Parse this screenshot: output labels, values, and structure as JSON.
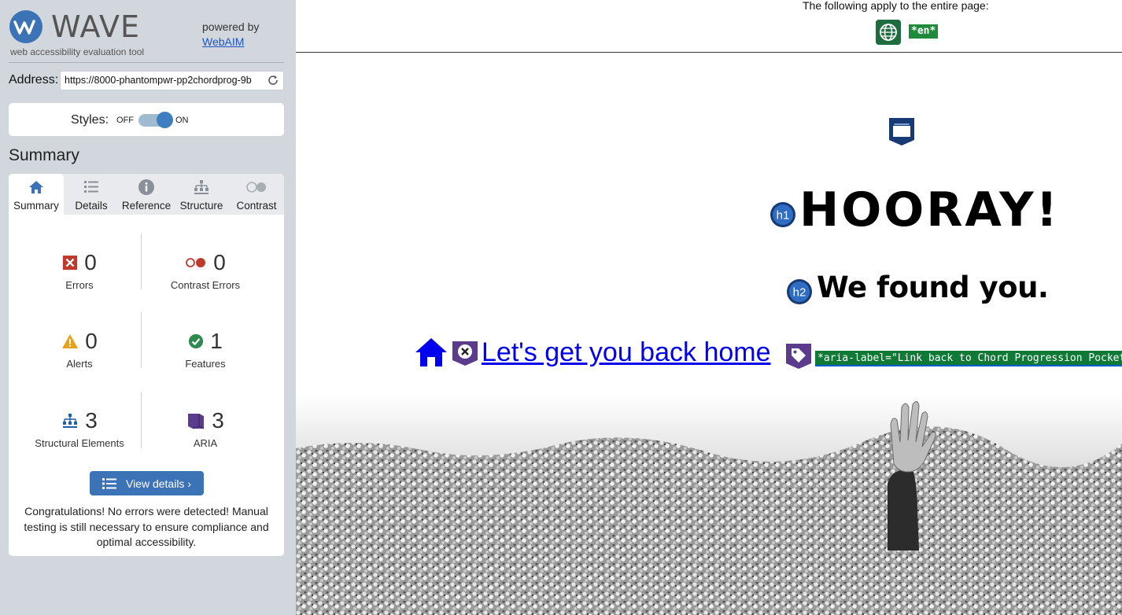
{
  "sidebar": {
    "brand": {
      "name": "WAVE",
      "tagline": "web accessibility evaluation tool",
      "powered_by": "powered by",
      "webaim_link": "WebAIM"
    },
    "address": {
      "label": "Address:",
      "value": "https://8000-phantompwr-pp2chordprog-9b"
    },
    "styles": {
      "label": "Styles:",
      "off": "OFF",
      "on": "ON",
      "state": "on"
    },
    "summary_heading": "Summary",
    "tabs": [
      {
        "label": "Summary",
        "icon": "home-icon",
        "active": true
      },
      {
        "label": "Details",
        "icon": "list-icon",
        "active": false
      },
      {
        "label": "Reference",
        "icon": "info-icon",
        "active": false
      },
      {
        "label": "Structure",
        "icon": "hierarchy-icon",
        "active": false
      },
      {
        "label": "Contrast",
        "icon": "contrast-toggle-icon",
        "active": false
      }
    ],
    "stats": {
      "errors": {
        "count": "0",
        "label": "Errors"
      },
      "contrast_errors": {
        "count": "0",
        "label": "Contrast Errors"
      },
      "alerts": {
        "count": "0",
        "label": "Alerts"
      },
      "features": {
        "count": "1",
        "label": "Features"
      },
      "structural": {
        "count": "3",
        "label": "Structural Elements"
      },
      "aria": {
        "count": "3",
        "label": "ARIA"
      }
    },
    "view_details": "View details ›",
    "congrats": "Congratulations! No errors were detected! Manual testing is still necessary to ensure compliance and optimal accessibility."
  },
  "preview": {
    "entire_page_note": "The following apply to the entire page:",
    "lang_badge": "*en*",
    "h1_badge": "h1",
    "h1_text": "HOORAY!",
    "h2_badge": "h2",
    "h2_text": "We found you.",
    "home_link": "Let's get you back home",
    "aria_label": "*aria-label=\"Link back to Chord Progression Pocket Guide home page\"*"
  },
  "colors": {
    "sidebar_bg": "#d2d7de",
    "accent_blue": "#3c73b6",
    "error_red": "#c0392b",
    "alert_orange": "#e8a218",
    "feature_green": "#2e8a4e",
    "aria_purple": "#5a3b8c",
    "structure_blue": "#1e5fa8"
  }
}
